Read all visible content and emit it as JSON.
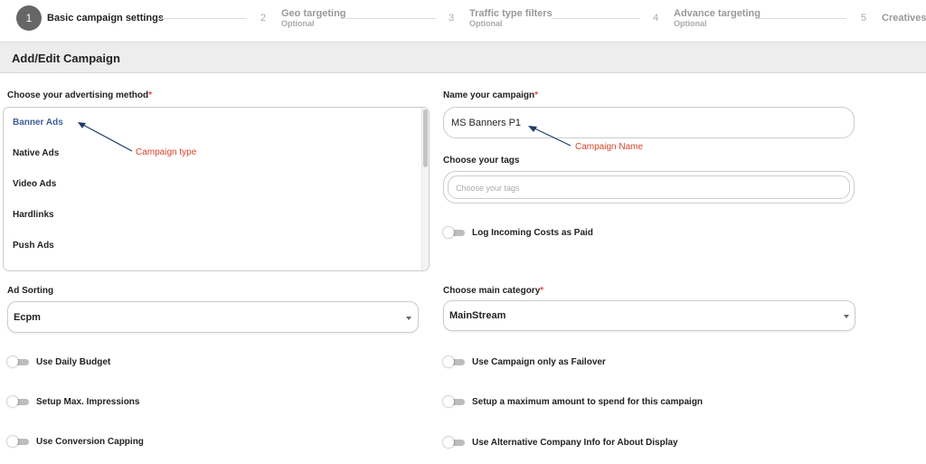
{
  "stepper": {
    "steps": [
      {
        "num": "1",
        "label": "Basic campaign settings",
        "sub": ""
      },
      {
        "num": "2",
        "label": "Geo targeting",
        "sub": "Optional"
      },
      {
        "num": "3",
        "label": "Traffic type filters",
        "sub": "Optional"
      },
      {
        "num": "4",
        "label": "Advance targeting",
        "sub": "Optional"
      },
      {
        "num": "5",
        "label": "Creatives",
        "sub": ""
      }
    ]
  },
  "header": {
    "title": "Add/Edit Campaign"
  },
  "method": {
    "label": "Choose your advertising method",
    "required": "*",
    "options": [
      "Banner Ads",
      "Native Ads",
      "Video Ads",
      "Hardlinks",
      "Push Ads"
    ]
  },
  "name": {
    "label": "Name your campaign",
    "required": "*",
    "value": "MS Banners P1"
  },
  "tags": {
    "label": "Choose your tags",
    "placeholder": "Choose your tags"
  },
  "toggles": {
    "log_costs": "Log Incoming Costs as Paid",
    "daily_budget": "Use Daily Budget",
    "failover": "Use Campaign only as Failover",
    "max_impressions": "Setup Max. Impressions",
    "max_spend": "Setup a maximum amount to spend for this campaign",
    "conversion_capping": "Use Conversion Capping",
    "alt_company": "Use Alternative Company Info for About Display"
  },
  "ad_sorting": {
    "label": "Ad Sorting",
    "value": "Ecpm"
  },
  "category": {
    "label": "Choose main category",
    "required": "*",
    "value": "MainStream"
  },
  "annotations": {
    "campaign_type": "Campaign type",
    "campaign_name": "Campaign Name"
  },
  "colors": {
    "annotation": "#d9442a",
    "arrow": "#1f3a6b",
    "selected_option": "#3f5f95"
  }
}
